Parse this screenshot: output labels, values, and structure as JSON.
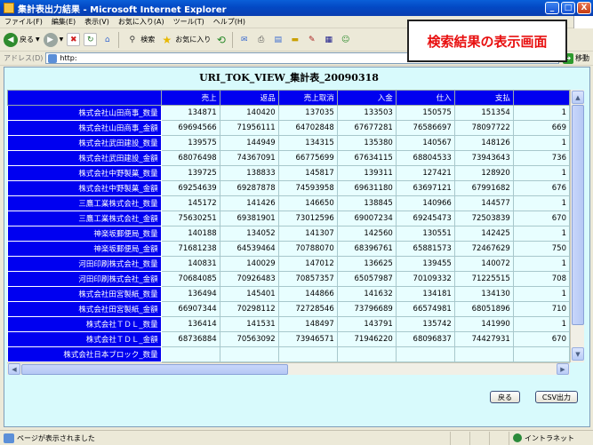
{
  "window": {
    "title": "集計表出力結果 - Microsoft Internet Explorer",
    "minimize": "_",
    "maximize": "□",
    "close": "X"
  },
  "menu": [
    "ファイル(F)",
    "編集(E)",
    "表示(V)",
    "お気に入り(A)",
    "ツール(T)",
    "ヘルプ(H)"
  ],
  "toolbar": {
    "back_label": "戻る",
    "search_label": "検索",
    "favorites_label": "お気に入り"
  },
  "address": {
    "label": "アドレス(D)",
    "value": "http:",
    "go_label": "移動"
  },
  "annotation": "検索結果の表示画面",
  "page": {
    "title": "URI_TOK_VIEW_集計表_20090318",
    "back_button": "戻る",
    "csv_button": "CSV出力"
  },
  "grid": {
    "headers": [
      "",
      "売上",
      "返品",
      "売上取消",
      "入金",
      "仕入",
      "支払",
      ""
    ],
    "rows": [
      {
        "name": "株式会社山田商事_数量",
        "values": [
          "134871",
          "140420",
          "137035",
          "133503",
          "150575",
          "151354",
          "1"
        ]
      },
      {
        "name": "株式会社山田商事_金額",
        "values": [
          "69694566",
          "71956111",
          "64702848",
          "67677281",
          "76586697",
          "78097722",
          "669"
        ]
      },
      {
        "name": "株式会社武田建設_数量",
        "values": [
          "139575",
          "144949",
          "134315",
          "135380",
          "140567",
          "148126",
          "1"
        ]
      },
      {
        "name": "株式会社武田建設_金額",
        "values": [
          "68076498",
          "74367091",
          "66775699",
          "67634115",
          "68804533",
          "73943643",
          "736"
        ]
      },
      {
        "name": "株式会社中野製菓_数量",
        "values": [
          "139725",
          "138833",
          "145817",
          "139311",
          "127421",
          "128920",
          "1"
        ]
      },
      {
        "name": "株式会社中野製菓_金額",
        "values": [
          "69254639",
          "69287878",
          "74593958",
          "69631180",
          "63697121",
          "67991682",
          "676"
        ]
      },
      {
        "name": "三鷹工業株式会社_数量",
        "values": [
          "145172",
          "141426",
          "146650",
          "138845",
          "140966",
          "144577",
          "1"
        ]
      },
      {
        "name": "三鷹工業株式会社_金額",
        "values": [
          "75630251",
          "69381901",
          "73012596",
          "69007234",
          "69245473",
          "72503839",
          "670"
        ]
      },
      {
        "name": "神楽坂郵便局_数量",
        "values": [
          "140188",
          "134052",
          "141307",
          "142560",
          "130551",
          "142425",
          "1"
        ]
      },
      {
        "name": "神楽坂郵便局_金額",
        "values": [
          "71681238",
          "64539464",
          "70788070",
          "68396761",
          "65881573",
          "72467629",
          "750"
        ]
      },
      {
        "name": "河田印刷株式会社_数量",
        "values": [
          "140831",
          "140029",
          "147012",
          "136625",
          "139455",
          "140072",
          "1"
        ]
      },
      {
        "name": "河田印刷株式会社_金額",
        "values": [
          "70684085",
          "70926483",
          "70857357",
          "65057987",
          "70109332",
          "71225515",
          "708"
        ]
      },
      {
        "name": "株式会社田宮製紙_数量",
        "values": [
          "136494",
          "145401",
          "144866",
          "141632",
          "134181",
          "134130",
          "1"
        ]
      },
      {
        "name": "株式会社田宮製紙_金額",
        "values": [
          "66907344",
          "70298112",
          "72728546",
          "73796689",
          "66574981",
          "68051896",
          "710"
        ]
      },
      {
        "name": "株式会社ＴＤＬ_数量",
        "values": [
          "136414",
          "141531",
          "148497",
          "143791",
          "135742",
          "141990",
          "1"
        ]
      },
      {
        "name": "株式会社ＴＤＬ_金額",
        "values": [
          "68736884",
          "70563092",
          "73946571",
          "71946220",
          "68096837",
          "74427931",
          "670"
        ]
      },
      {
        "name": "株式会社日本ブロック_数量",
        "values": [
          "",
          "",
          "",
          "",
          "",
          "",
          ""
        ]
      }
    ]
  },
  "status": {
    "text": "ページが表示されました",
    "zone": "イントラネット"
  }
}
